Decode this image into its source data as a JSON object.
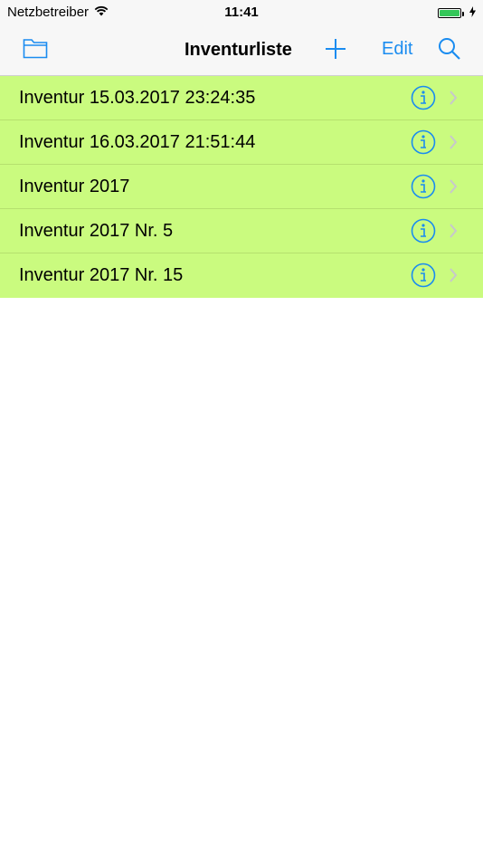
{
  "status_bar": {
    "carrier": "Netzbetreiber",
    "time": "11:41",
    "battery_color": "#34c759"
  },
  "nav": {
    "title": "Inventurliste",
    "edit_label": "Edit",
    "accent_color": "#1a8cf0",
    "left_icon": "folder-icon",
    "add_icon": "plus-icon",
    "search_icon": "search-icon"
  },
  "list": {
    "row_color": "#cafb7f",
    "items": [
      {
        "label": "Inventur 15.03.2017 23:24:35"
      },
      {
        "label": "Inventur 16.03.2017 21:51:44"
      },
      {
        "label": "Inventur 2017"
      },
      {
        "label": "Inventur 2017 Nr. 5"
      },
      {
        "label": "Inventur 2017 Nr. 15"
      }
    ]
  }
}
